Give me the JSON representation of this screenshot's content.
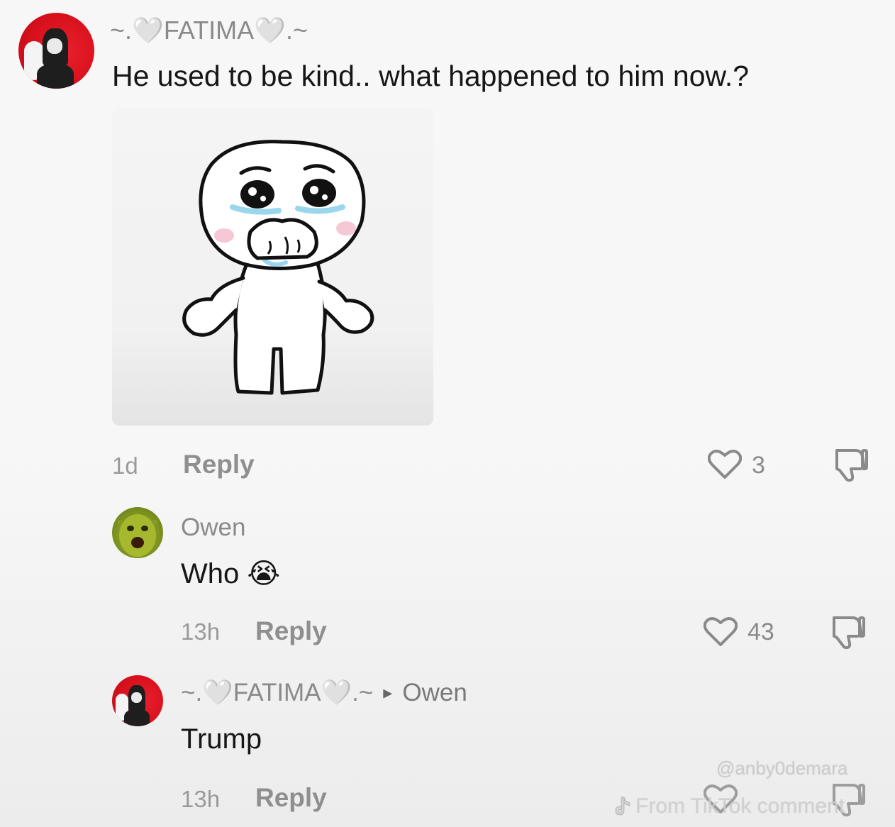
{
  "comments": [
    {
      "username": "~.🤍FATIMA🤍.~",
      "text": "He used to be kind.. what happened to him now.?",
      "time": "1d",
      "reply_label": "Reply",
      "likes": "3",
      "has_image": true
    },
    {
      "username": "Owen",
      "text": "Who 😭",
      "time": "13h",
      "reply_label": "Reply",
      "likes": "43"
    },
    {
      "username": "~.🤍FATIMA🤍.~",
      "reply_to": "Owen",
      "reply_arrow": "▸",
      "text": "Trump",
      "time": "13h",
      "reply_label": "Reply",
      "likes": ""
    }
  ],
  "watermark": {
    "handle": "@anby0demara",
    "source": "From TikTok comment"
  },
  "icons": {
    "heart": "heart-outline-icon",
    "dislike": "thumbs-down-icon",
    "tiktok": "tiktok-logo-icon"
  }
}
